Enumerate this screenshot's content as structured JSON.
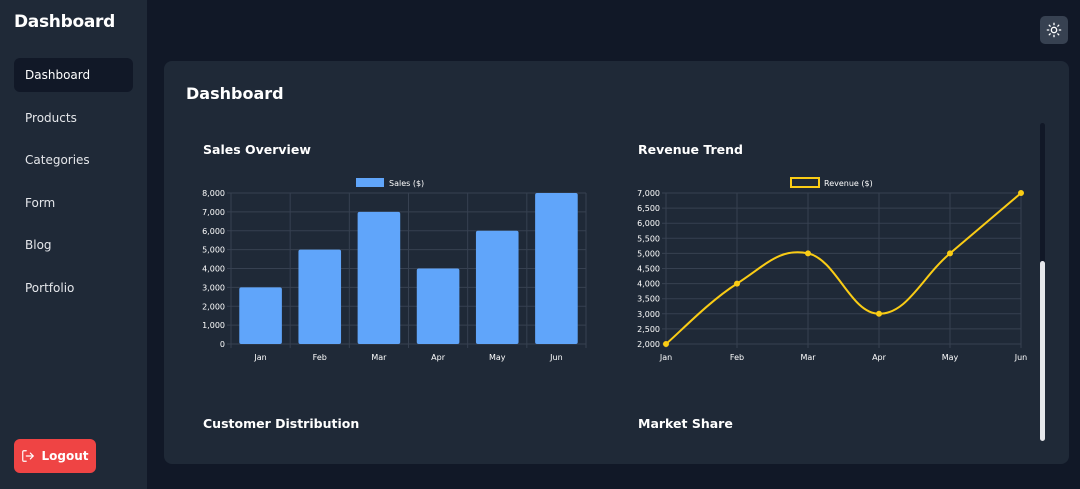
{
  "sidebar": {
    "brand": "Dashboard",
    "items": [
      {
        "label": "Dashboard",
        "active": true
      },
      {
        "label": "Products",
        "active": false
      },
      {
        "label": "Categories",
        "active": false
      },
      {
        "label": "Form",
        "active": false
      },
      {
        "label": "Blog",
        "active": false
      },
      {
        "label": "Portfolio",
        "active": false
      }
    ],
    "logout_label": "Logout"
  },
  "header": {
    "theme_toggle_icon": "sun-icon"
  },
  "main": {
    "title": "Dashboard",
    "cards": [
      {
        "title": "Sales Overview"
      },
      {
        "title": "Revenue Trend"
      },
      {
        "title": "Customer Distribution"
      },
      {
        "title": "Market Share"
      }
    ]
  },
  "colors": {
    "bar": "#60a5fa",
    "line": "#facc15",
    "grid": "#374151",
    "logout": "#ef4444"
  },
  "chart_data": [
    {
      "type": "bar",
      "categories": [
        "Jan",
        "Feb",
        "Mar",
        "Apr",
        "May",
        "Jun"
      ],
      "series": [
        {
          "name": "Sales ($)",
          "values": [
            3000,
            5000,
            7000,
            4000,
            6000,
            8000
          ]
        }
      ],
      "yticks": [
        "0",
        "1,000",
        "2,000",
        "3,000",
        "4,000",
        "5,000",
        "6,000",
        "7,000",
        "8,000"
      ],
      "ylim": [
        0,
        8000
      ],
      "grid": true,
      "legend": "top-center"
    },
    {
      "type": "line",
      "categories": [
        "Jan",
        "Feb",
        "Mar",
        "Apr",
        "May",
        "Jun"
      ],
      "series": [
        {
          "name": "Revenue ($)",
          "values": [
            2000,
            4000,
            5000,
            3000,
            5000,
            7000
          ]
        }
      ],
      "yticks": [
        "2,000",
        "2,500",
        "3,000",
        "3,500",
        "4,000",
        "4,500",
        "5,000",
        "5,500",
        "6,000",
        "6,500",
        "7,000"
      ],
      "ylim": [
        2000,
        7000
      ],
      "grid": true,
      "legend": "top-center"
    }
  ]
}
